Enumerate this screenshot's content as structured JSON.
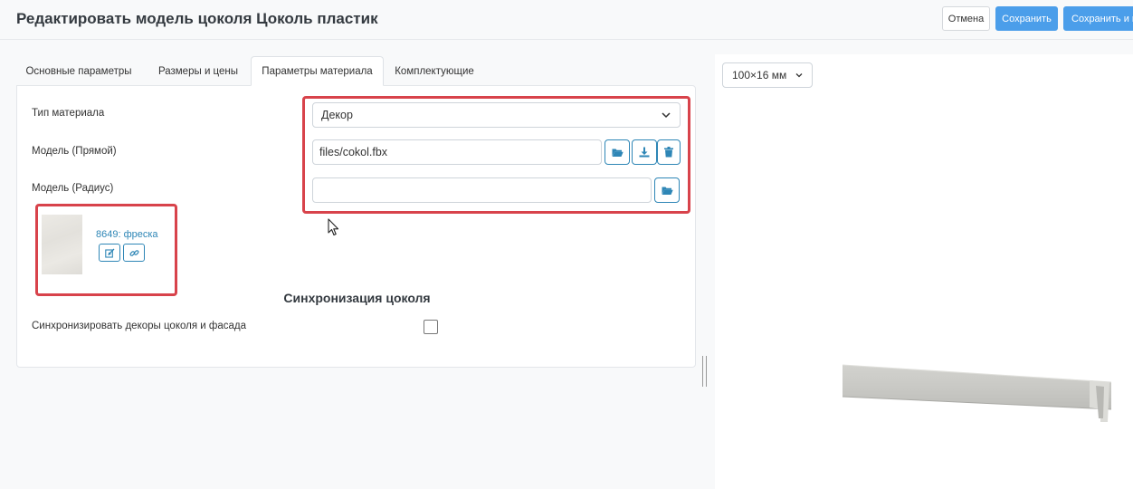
{
  "header": {
    "title": "Редактировать модель цоколя Цоколь пластик",
    "cancel_label": "Отмена",
    "save_label": "Сохранить",
    "save_close_label": "Сохранить и в"
  },
  "tabs": [
    {
      "label": "Основные параметры",
      "active": false
    },
    {
      "label": "Размеры и цены",
      "active": false
    },
    {
      "label": "Параметры материала",
      "active": true
    },
    {
      "label": "Комплектующие",
      "active": false
    }
  ],
  "form": {
    "material_type": {
      "label": "Тип материала",
      "value": "Декор"
    },
    "model_straight": {
      "label": "Модель (Прямой)",
      "value": "files/cokol.fbx"
    },
    "model_radius": {
      "label": "Модель (Радиус)",
      "value": ""
    }
  },
  "decor": {
    "name": "8649: фреска"
  },
  "sync": {
    "title": "Синхронизация цоколя",
    "checkbox_label": "Синхронизировать декоры цоколя и фасада",
    "checked": false
  },
  "viewer": {
    "size_value": "100×16 мм"
  },
  "colors": {
    "accent": "#4b9eea",
    "icon_blue": "#2e86b6",
    "highlight_red": "#d8434b"
  }
}
